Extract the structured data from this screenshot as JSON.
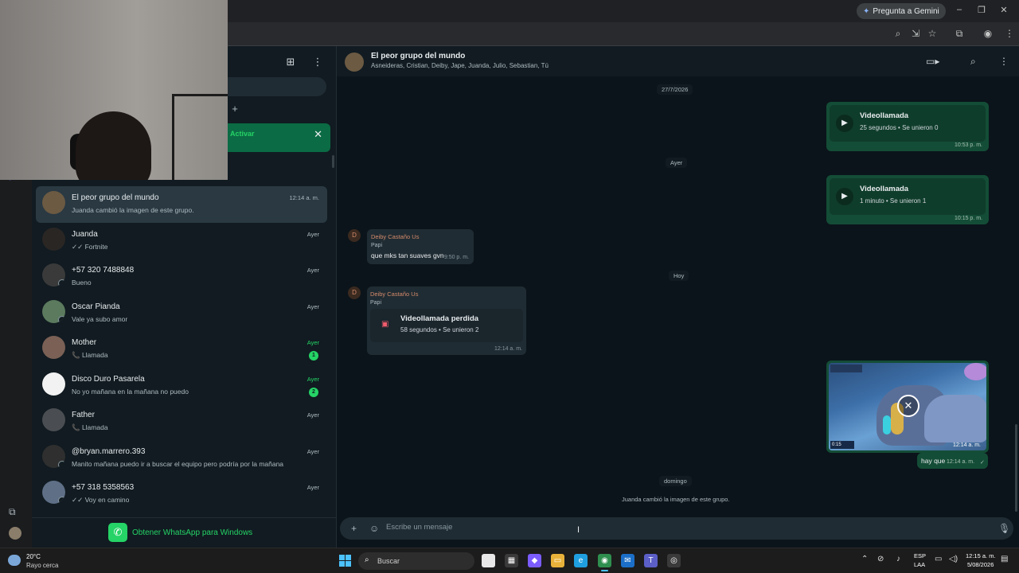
{
  "browser": {
    "gemini_label": "Pregunta a Gemini",
    "gemini_icon": "sparkle-icon"
  },
  "sidebar": {
    "notice_action": "Activar",
    "chats": [
      {
        "name": "El peor grupo del mundo",
        "last": "Juanda cambió la imagen de este grupo.",
        "time": "12:14 a. m.",
        "active": true
      },
      {
        "name": "Juanda",
        "last": "✓✓ Fortnite",
        "time": "Ayer"
      },
      {
        "name": "+57 320 7488848",
        "last": "Bueno",
        "time": "Ayer"
      },
      {
        "name": "Oscar Pianda",
        "last": "Vale ya subo amor",
        "time": "Ayer"
      },
      {
        "name": "Mother",
        "last": "📞 Llamada",
        "time": "Ayer",
        "unread": "1"
      },
      {
        "name": "Disco Duro Pasarela",
        "last": "No yo mañana en la mañana no puedo",
        "time": "Ayer",
        "unread": "2"
      },
      {
        "name": "Father",
        "last": "📞 Llamada",
        "time": "Ayer"
      },
      {
        "name": "@bryan.marrero.393",
        "last": "Manito mañana puedo ir a buscar el equipo pero podría por la mañana",
        "time": "Ayer"
      },
      {
        "name": "+57 318 5358563",
        "last": "✓✓ Voy en camino",
        "time": "Ayer"
      }
    ],
    "get_app": "Obtener WhatsApp para Windows"
  },
  "conversation": {
    "title": "El peor grupo del mundo",
    "members": "Asneideras, Cristian, Deiby, Jape, Juanda, Julio, Sebastian, Tú",
    "dates": {
      "first": "27/7/2026",
      "second": "Ayer",
      "third": "Hoy",
      "fourth": "domingo"
    },
    "call1": {
      "title": "Videollamada",
      "sub": "25 segundos • Se unieron 0",
      "time": "10:53 p. m."
    },
    "call2": {
      "title": "Videollamada",
      "sub": "1 minuto • Se unieron 1",
      "time": "10:15 p. m."
    },
    "msg1": {
      "sender": "Deiby Castaño Us",
      "alias": "Papi",
      "text": "que mks tan suaves gvn",
      "time": "9:50 p. m."
    },
    "msg2": {
      "sender": "Deiby Castaño Us",
      "alias": "Papi",
      "title": "Videollamada perdida",
      "sub": "58 segundos • Se unieron 2",
      "time": "12:14 a. m."
    },
    "image_time": "12:14 a. m.",
    "image_hud": "0:15",
    "text_out": {
      "text": "hay que",
      "time": "12:14 a. m."
    },
    "system": "Juanda cambió la imagen de este grupo.",
    "composer_placeholder": "Escribe un mensaje"
  },
  "taskbar": {
    "temp": "20°C",
    "condition": "Rayo cerca",
    "search": "Buscar",
    "lang1": "ESP",
    "lang2": "LAA",
    "time": "12:15 a. m.",
    "date": "5/08/2026"
  },
  "colors": {
    "accent": "#25d366",
    "outgoing": "#144d37",
    "incoming": "#202c33",
    "missed": "#f15c6d"
  }
}
